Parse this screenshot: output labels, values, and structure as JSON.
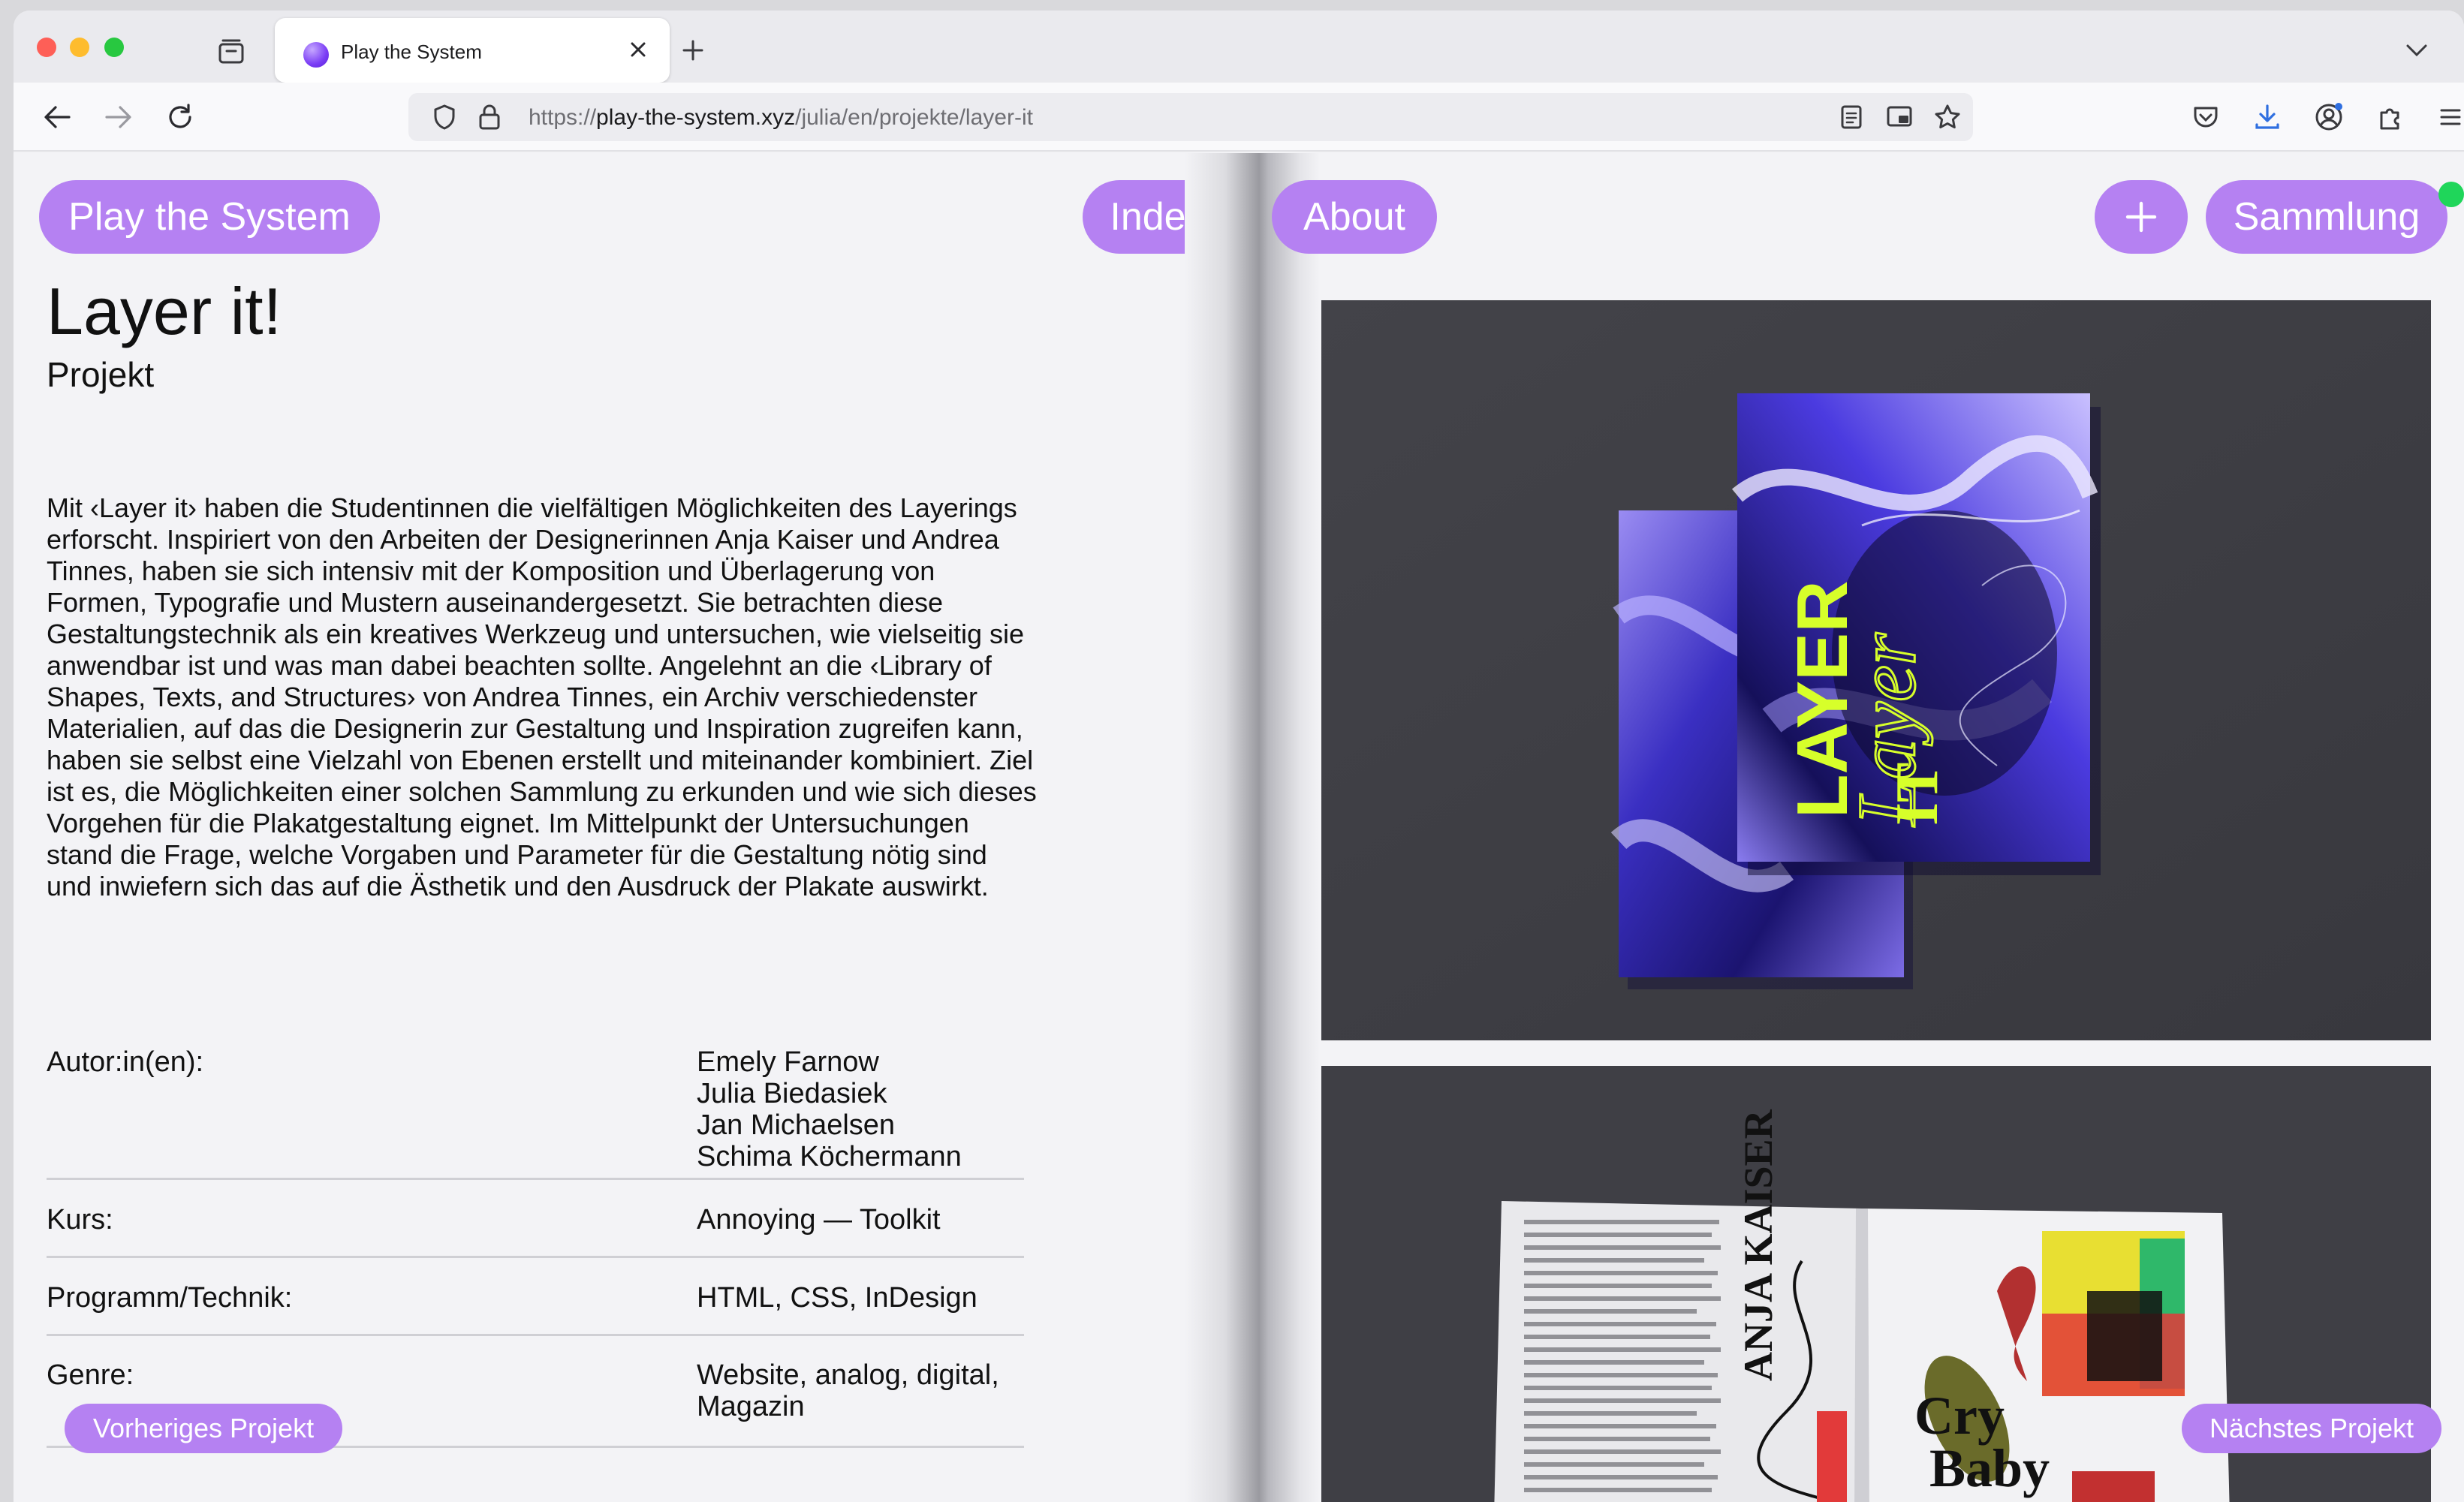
{
  "browser": {
    "tab_title": "Play the System",
    "url_scheme": "https://",
    "url_host": "play-the-system.xyz",
    "url_path": "/julia/en/projekte/layer-it"
  },
  "site": {
    "brand_label": "Play the System",
    "nav_index": "Index",
    "nav_about": "About",
    "add_label": "+",
    "collection_label": "Sammlung",
    "accent_color": "#b581f2",
    "status_color": "#1fd65a"
  },
  "project": {
    "title": "Layer it!",
    "subtitle": "Projekt",
    "description": "Mit ‹Layer it› haben die Studentinnen die vielfältigen Möglichkeiten des Layerings erforscht. Inspiriert von den Arbeiten der Designerinnen Anja Kaiser und Andrea Tinnes, haben sie sich intensiv mit der Komposition und Überlagerung von Formen, Typografie und Mustern auseinandergesetzt. Sie betrachten diese Gestaltungstechnik als ein kreatives Werkzeug und untersuchen, wie vielseitig sie anwendbar ist und was man dabei beachten sollte. Angelehnt an die ‹Library of Shapes, Texts, and Structures› von Andrea Tinnes, ein Archiv verschiedenster Materialien, auf das die Designerin zur Gestaltung und Inspiration zugreifen kann, haben sie selbst eine Vielzahl von Ebenen erstellt und miteinander kombiniert. Ziel ist es, die Möglichkeiten einer solchen Sammlung zu erkunden und wie sich dieses Vorgehen für die Plakatgestaltung eignet. Im Mittelpunkt der Untersuchungen stand die Frage, welche Vorgaben und Parameter für die Gestaltung nötig sind und inwiefern sich das auf die Ästhetik und den Ausdruck der Plakate auswirkt.",
    "meta": {
      "authors_label": "Autor:in(en):",
      "authors": [
        "Emely Farnow",
        "Julia Biedasiek",
        "Jan Michaelsen",
        "Schima Köchermann"
      ],
      "course_label": "Kurs:",
      "course": "Annoying — Toolkit",
      "tech_label": "Programm/Technik:",
      "tech": "HTML, CSS, InDesign",
      "genre_label": "Genre:",
      "genre_line1": "Website, analog, digital,",
      "genre_line2": "Magazin"
    },
    "prev_label": "Vorheriges Projekt",
    "next_label": "Nächstes Projekt"
  },
  "images": {
    "cover_text_1": "LAYER",
    "cover_text_2": "Layer",
    "cover_text_3": "IT",
    "spread_heading": "ANJA KAISER",
    "spread_text_1": "Cry",
    "spread_text_2": "Baby"
  }
}
